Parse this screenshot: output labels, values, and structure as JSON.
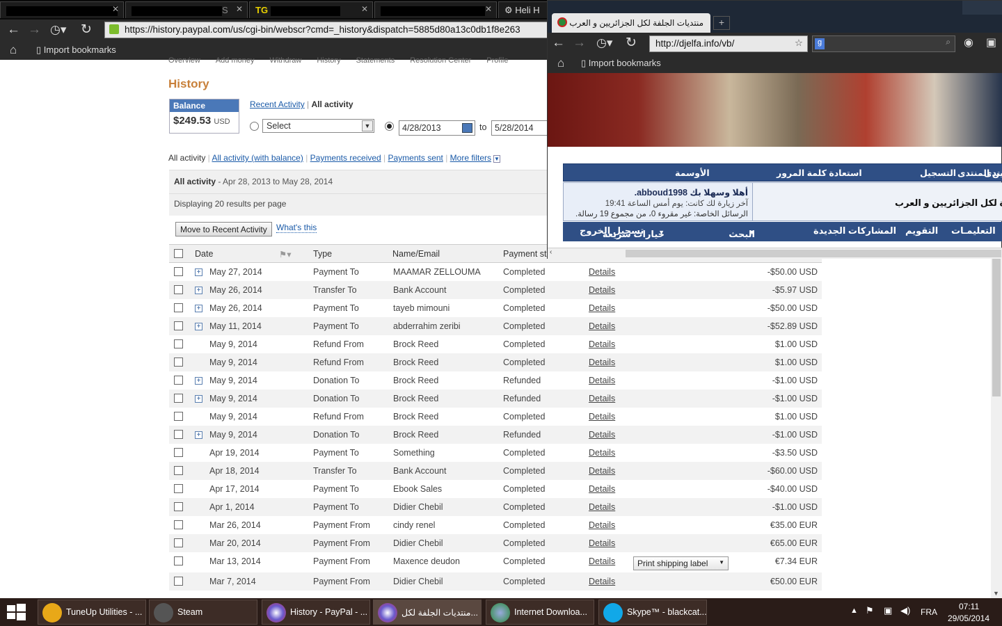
{
  "browser1": {
    "tabs": [
      {
        "label": "S"
      },
      {
        "label": "TG"
      },
      {
        "label": "Heli H"
      }
    ],
    "url": "https://history.paypal.com/us/cgi-bin/webscr?cmd=_history&dispatch=5885d80a13c0db1f8e263",
    "bookmark": "Import bookmarks"
  },
  "paypal": {
    "nav": [
      "Overview",
      "Add money",
      "Withdraw",
      "History",
      "Statements",
      "Resolution Center",
      "Profile"
    ],
    "title": "History",
    "balance_label": "Balance",
    "balance_value": "$249.53",
    "balance_currency": "USD",
    "recent_activity": "Recent Activity",
    "all_activity": "All activity",
    "select_placeholder": "Select",
    "date_from": "4/28/2013",
    "to_label": "to",
    "date_to": "5/28/2014",
    "filters": [
      "All activity",
      "All activity (with balance)",
      "Payments received",
      "Payments sent",
      "More filters"
    ],
    "summary_title": "All activity",
    "summary_range": "- Apr 28, 2013 to May 28, 2014",
    "display_text": "Displaying 20 results per page",
    "move_button": "Move to Recent Activity",
    "whats_this": "What's this",
    "columns": [
      "Date",
      "Type",
      "Name/Email",
      "Payment st"
    ],
    "details_label": "Details",
    "print_label": "Print shipping label",
    "rows": [
      {
        "date": "May 27, 2014",
        "type": "Payment To",
        "name": "MAAMAR ZELLOUMA",
        "status": "Completed",
        "amount": "-$50.00 USD",
        "plus": true
      },
      {
        "date": "May 26, 2014",
        "type": "Transfer To",
        "name": "Bank Account",
        "status": "Completed",
        "amount": "-$5.97 USD",
        "plus": true
      },
      {
        "date": "May 26, 2014",
        "type": "Payment To",
        "name": "tayeb mimouni",
        "status": "Completed",
        "amount": "-$50.00 USD",
        "plus": true
      },
      {
        "date": "May 11, 2014",
        "type": "Payment To",
        "name": "abderrahim zeribi",
        "status": "Completed",
        "amount": "-$52.89 USD",
        "plus": true
      },
      {
        "date": "May 9, 2014",
        "type": "Refund From",
        "name": "Brock Reed",
        "status": "Completed",
        "amount": "$1.00 USD",
        "plus": false
      },
      {
        "date": "May 9, 2014",
        "type": "Refund From",
        "name": "Brock Reed",
        "status": "Completed",
        "amount": "$1.00 USD",
        "plus": false
      },
      {
        "date": "May 9, 2014",
        "type": "Donation To",
        "name": "Brock Reed",
        "status": "Refunded",
        "amount": "-$1.00 USD",
        "plus": true
      },
      {
        "date": "May 9, 2014",
        "type": "Donation To",
        "name": "Brock Reed",
        "status": "Refunded",
        "amount": "-$1.00 USD",
        "plus": true
      },
      {
        "date": "May 9, 2014",
        "type": "Refund From",
        "name": "Brock Reed",
        "status": "Completed",
        "amount": "$1.00 USD",
        "plus": false
      },
      {
        "date": "May 9, 2014",
        "type": "Donation To",
        "name": "Brock Reed",
        "status": "Refunded",
        "amount": "-$1.00 USD",
        "plus": true
      },
      {
        "date": "Apr 19, 2014",
        "type": "Payment To",
        "name": "Something",
        "status": "Completed",
        "amount": "-$3.50 USD",
        "plus": false
      },
      {
        "date": "Apr 18, 2014",
        "type": "Transfer To",
        "name": "Bank Account",
        "status": "Completed",
        "amount": "-$60.00 USD",
        "plus": false
      },
      {
        "date": "Apr 17, 2014",
        "type": "Payment To",
        "name": "Ebook Sales",
        "status": "Completed",
        "amount": "-$40.00 USD",
        "plus": false
      },
      {
        "date": "Apr 1, 2014",
        "type": "Payment To",
        "name": "Didier Chebil",
        "status": "Completed",
        "amount": "-$1.00 USD",
        "plus": false
      },
      {
        "date": "Mar 26, 2014",
        "type": "Payment From",
        "name": "cindy renel",
        "status": "Completed",
        "amount": "€35.00 EUR",
        "plus": false
      },
      {
        "date": "Mar 20, 2014",
        "type": "Payment From",
        "name": "Didier Chebil",
        "status": "Completed",
        "amount": "€65.00 EUR",
        "plus": false
      },
      {
        "date": "Mar 13, 2014",
        "type": "Payment From",
        "name": "Maxence deudon",
        "status": "Completed",
        "amount": "€7.34 EUR",
        "plus": false
      },
      {
        "date": "Mar 7, 2014",
        "type": "Payment From",
        "name": "Didier Chebil",
        "status": "Completed",
        "amount": "€50.00 EUR",
        "plus": false
      }
    ]
  },
  "browser2": {
    "tab_title": "منتديات الجلفة لكل الجزائريين و العرب",
    "url": "http://djelfa.info/vb/",
    "bookmark": "Import bookmarks",
    "nav1": [
      "قوانين المنتدى",
      "الأوسمة",
      "استعادة كلمة المرور",
      "التسجيل",
      "منتدى"
    ],
    "welcome": "أهلا وسهلا بك abboud1998.",
    "last_visit": "آخر زيارة لك كانت: يوم أمس الساعة 19:41",
    "messages": "الرسائل الخاصة: غير مقروء 0، من مجموع 19 رسالة.",
    "forum_title": "ة لكل الجزائريين و العرب",
    "nav2": [
      "تسجيل الخروج",
      "خيارات سريعة",
      "البحث",
      "المشاركات الجديدة",
      "التقويم",
      "التعليمـات"
    ]
  },
  "taskbar": {
    "items": [
      "TuneUp Utilities - ...",
      "Steam",
      "History - PayPal - ...",
      "منتديات الجلفة لكل...",
      "Internet Downloa...",
      "Skype™ - blackcat..."
    ],
    "lang": "FRA",
    "time": "07:11",
    "date": "29/05/2014"
  }
}
